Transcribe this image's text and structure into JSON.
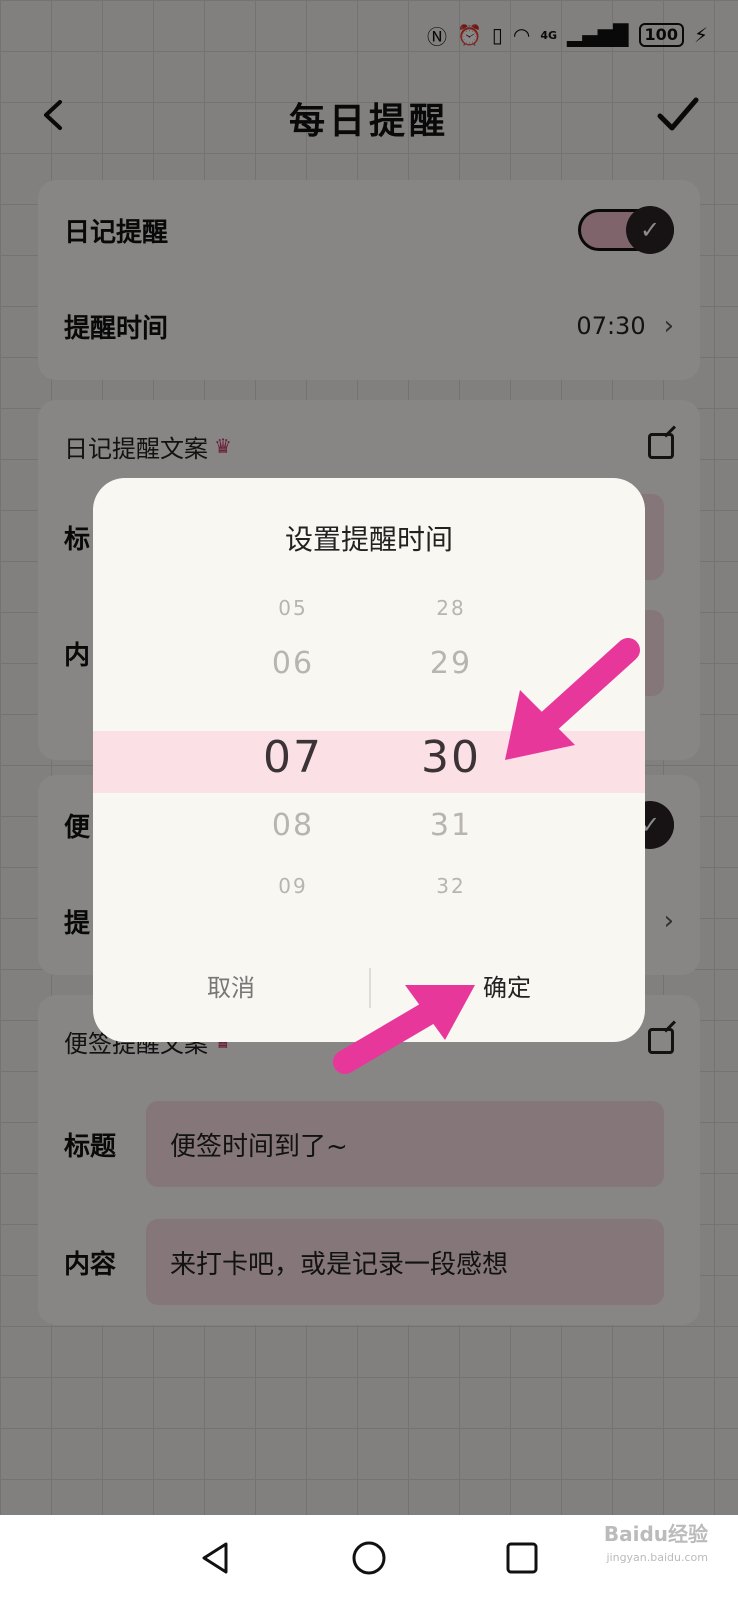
{
  "status_bar": {
    "nfc_icon": "nfc-icon",
    "alarm_icon": "alarm-icon",
    "vibrate_icon": "vibrate-icon",
    "wifi_icon": "wifi-icon",
    "signal_label": "4G",
    "battery": "100"
  },
  "header": {
    "title": "每日提醒"
  },
  "diary_card": {
    "toggle_label": "日记提醒",
    "toggle_on": true,
    "time_label": "提醒时间",
    "time_value": "07:30"
  },
  "diary_copy_card": {
    "section_label": "日记提醒文案",
    "title_label": "标",
    "content_label": "内"
  },
  "note_card": {
    "toggle_label": "便",
    "time_label": "提"
  },
  "note_copy_card": {
    "section_label": "便签提醒文案",
    "title_label": "标题",
    "title_value": "便签时间到了~",
    "content_label": "内容",
    "content_value": "来打卡吧，或是记录一段感想"
  },
  "dialog": {
    "title": "设置提醒时间",
    "hours": [
      "05",
      "06",
      "07",
      "08",
      "09"
    ],
    "minutes": [
      "28",
      "29",
      "30",
      "31",
      "32"
    ],
    "selected_hour": "07",
    "selected_minute": "30",
    "cancel_label": "取消",
    "ok_label": "确定"
  },
  "annotations": {
    "arrow_color": "#e8379a"
  },
  "watermark": {
    "text": "Baidu经验",
    "url": "jingyan.baidu.com"
  },
  "colors": {
    "accent_pink": "#f1d8dd",
    "picker_highlight": "#fbe0e6",
    "dark": "#2a2327"
  }
}
